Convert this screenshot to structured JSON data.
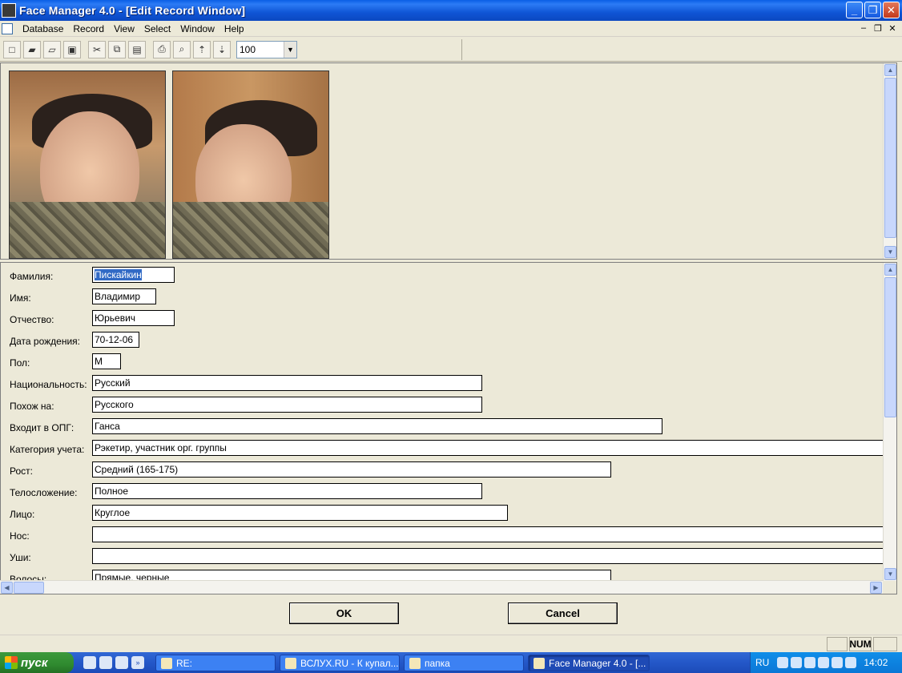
{
  "window": {
    "title": "Face Manager 4.0 - [Edit Record Window]",
    "minimize": "_",
    "maximize": "❐",
    "close": "✕"
  },
  "menu": {
    "items": [
      "Database",
      "Record",
      "View",
      "Select",
      "Window",
      "Help"
    ],
    "mdi_minimize": "–",
    "mdi_restore": "❐",
    "mdi_close": "✕"
  },
  "toolbar": {
    "zoom_value": "100"
  },
  "form": {
    "rows": [
      {
        "label": "Фамилия:",
        "value": "Пискайкин"
      },
      {
        "label": "Имя:",
        "value": "Владимир"
      },
      {
        "label": "Отчество:",
        "value": "Юрьевич"
      },
      {
        "label": "Дата рождения:",
        "value": "70-12-06"
      },
      {
        "label": "Пол:",
        "value": "М"
      },
      {
        "label": "Национальность:",
        "value": "Русский"
      },
      {
        "label": "Похож на:",
        "value": "Русского"
      },
      {
        "label": "Входит в ОПГ:",
        "value": "Ганса"
      },
      {
        "label": "Категория учета:",
        "value": "Рэкетир, участник орг. группы"
      },
      {
        "label": "Рост:",
        "value": "Средний (165-175)"
      },
      {
        "label": "Телосложение:",
        "value": "Полное"
      },
      {
        "label": "Лицо:",
        "value": "Круглое"
      },
      {
        "label": "Нос:",
        "value": ""
      },
      {
        "label": "Уши:",
        "value": ""
      },
      {
        "label": "Волосы:",
        "value": "Прямые, черные"
      }
    ]
  },
  "buttons": {
    "ok": "OK",
    "cancel": "Cancel"
  },
  "status": {
    "num": "NUM"
  },
  "taskbar": {
    "start": "пуск",
    "tasks": [
      "RE:",
      "ВСЛУХ.RU - К купал...",
      "папка",
      "Face Manager 4.0 - [..."
    ],
    "lang": "RU",
    "clock": "14:02"
  }
}
